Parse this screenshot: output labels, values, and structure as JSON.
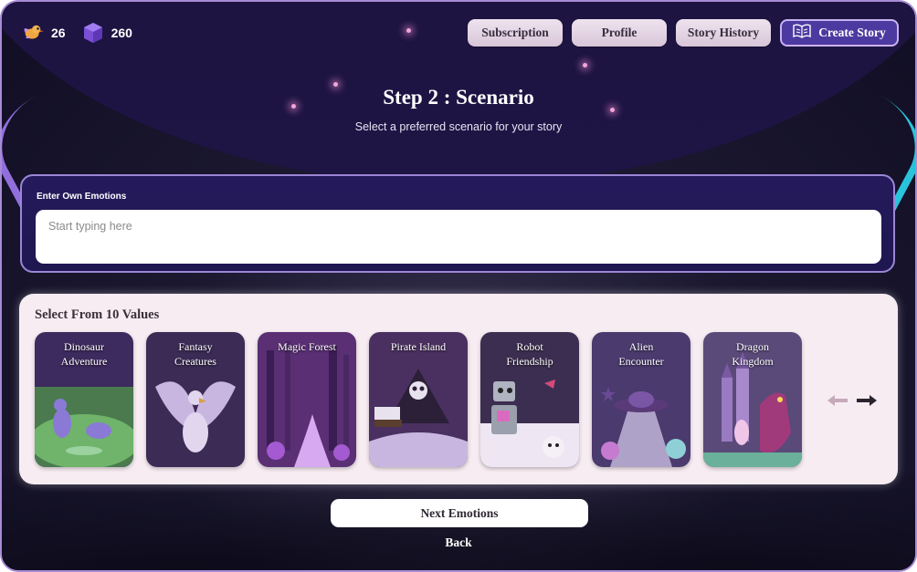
{
  "header": {
    "stats": [
      {
        "icon": "bird-mascot-icon",
        "value": "26"
      },
      {
        "icon": "purple-gem-icon",
        "value": "260"
      }
    ],
    "nav": {
      "subscription_label": "Subscription",
      "profile_label": "Profile",
      "history_label": "Story History",
      "create_label": "Create Story",
      "create_icon": "open-book-icon"
    }
  },
  "step": {
    "title": "Step 2 : Scenario",
    "subtitle": "Select a preferred scenario for your story"
  },
  "own_input": {
    "label": "Enter Own Emotions",
    "placeholder": "Start typing here",
    "value": ""
  },
  "values": {
    "title": "Select From 10 Values",
    "cards": [
      {
        "label": "Dinosaur\nAdventure"
      },
      {
        "label": "Fantasy\nCreatures"
      },
      {
        "label": "Magic Forest"
      },
      {
        "label": "Pirate Island"
      },
      {
        "label": "Robot\nFriendship"
      },
      {
        "label": "Alien\nEncounter"
      },
      {
        "label": "Dragon\nKingdom"
      }
    ],
    "prev_icon": "arrow-left-icon",
    "next_icon": "arrow-right-icon"
  },
  "actions": {
    "next_label": "Next Emotions",
    "back_label": "Back"
  },
  "colors": {
    "accent_purple": "#4d3aa0",
    "panel_bg": "#f7ecf2",
    "glow_left": "#9f7af0",
    "glow_right": "#2cd8f0"
  }
}
